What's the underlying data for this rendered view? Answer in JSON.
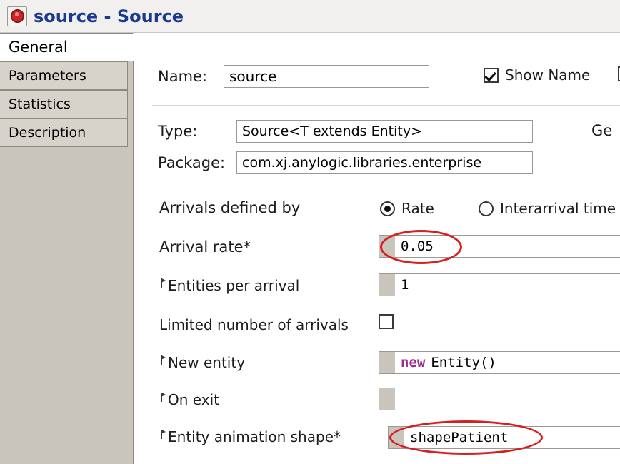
{
  "window": {
    "title": "source - Source",
    "icon": "anylogic-app-icon"
  },
  "tabs": [
    {
      "label": "General",
      "selected": true
    },
    {
      "label": "Parameters",
      "selected": false
    },
    {
      "label": "Statistics",
      "selected": false
    },
    {
      "label": "Description",
      "selected": false
    }
  ],
  "properties": {
    "name_label": "Name:",
    "name_value": "source",
    "show_name_label": "Show Name",
    "show_name_checked": true,
    "extra_checkbox_checked": false,
    "type_label": "Type:",
    "type_value": "Source<T extends Entity>",
    "package_label": "Package:",
    "package_value": "com.xj.anylogic.libraries.enterprise",
    "generic_label": "Ge",
    "arrivals_label": "Arrivals defined by",
    "arrivals_option_rate": "Rate",
    "arrivals_option_interarrival": "Interarrival time",
    "arrivals_selected": "Rate",
    "arrival_rate_label": "Arrival rate*",
    "arrival_rate_value": "0.05",
    "entities_per_arrival_label": "Entities per arrival",
    "entities_per_arrival_value": "1",
    "limited_number_label": "Limited number of arrivals",
    "limited_number_checked": false,
    "new_entity_label": "New entity",
    "new_entity_keyword": "new",
    "new_entity_expr": "Entity()",
    "on_exit_label": "On exit",
    "on_exit_value": "",
    "entity_animation_label": "Entity animation shape*",
    "entity_animation_value": "shapePatient"
  },
  "annotations": {
    "highlight_color": "#d81f1f",
    "highlights": [
      "arrival-rate-field",
      "entity-animation-shape-field"
    ]
  }
}
